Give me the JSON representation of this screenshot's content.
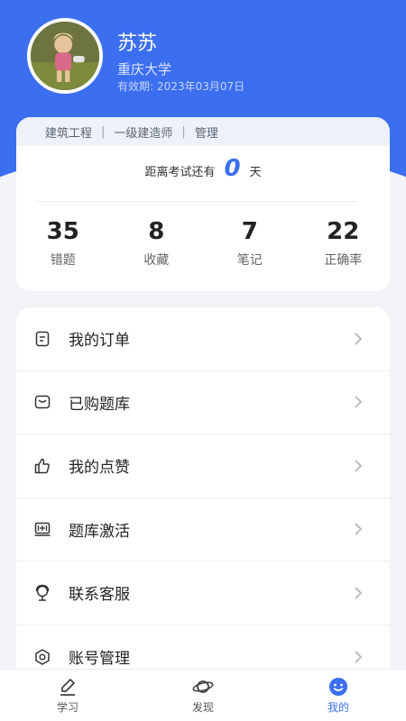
{
  "profile": {
    "name": "苏苏",
    "school": "重庆大学",
    "valid_label": "有效期:",
    "valid_date": "2023年03月07日"
  },
  "exam": {
    "subjects": [
      "建筑工程",
      "一级建造师",
      "管理"
    ],
    "countdown_prefix": "距离考试还有",
    "countdown_days": "0",
    "countdown_suffix": "天"
  },
  "stats": [
    {
      "value": "35",
      "label": "错题"
    },
    {
      "value": "8",
      "label": "收藏"
    },
    {
      "value": "7",
      "label": "笔记"
    },
    {
      "value": "22",
      "label": "正确率"
    }
  ],
  "menu": [
    {
      "label": "我的订单",
      "icon": "order-icon"
    },
    {
      "label": "已购题库",
      "icon": "purchased-icon"
    },
    {
      "label": "我的点赞",
      "icon": "thumbs-up-icon"
    },
    {
      "label": "题库激活",
      "icon": "activate-icon"
    },
    {
      "label": "联系客服",
      "icon": "customer-service-icon"
    },
    {
      "label": "账号管理",
      "icon": "settings-icon"
    }
  ],
  "tabs": [
    {
      "label": "学习",
      "icon": "pencil-icon",
      "active": false
    },
    {
      "label": "发现",
      "icon": "planet-icon",
      "active": false
    },
    {
      "label": "我的",
      "icon": "smile-icon",
      "active": true
    }
  ],
  "colors": {
    "accent": "#3b6ff0",
    "background": "#f2f3f7"
  }
}
